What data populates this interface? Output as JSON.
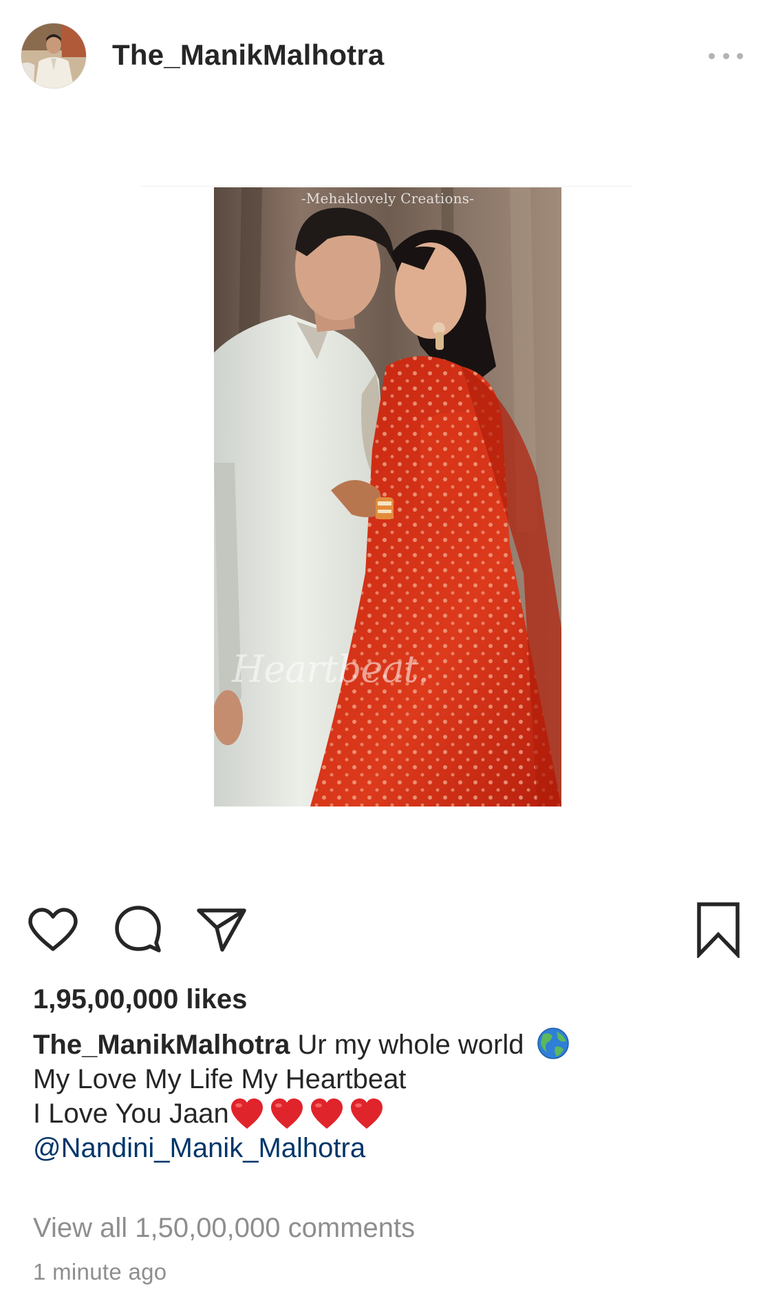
{
  "post": {
    "username": "The_ManikMalhotra",
    "media": {
      "watermark_text": "-Mehaklovely Creations-",
      "signature_text": "Heartbeat."
    },
    "likes_text": "1,95,00,000 likes",
    "caption": {
      "username": "The_ManikMalhotra",
      "line1_text": "Ur my whole world",
      "line1_emoji": "globe-icon",
      "line2_text": "My Love My Life My Heartbeat",
      "line3_text": "I Love You Jaan",
      "line3_emoji": "red-heart-icon",
      "line3_emoji_count": 4,
      "mention": "@Nandini_Manik_Malhotra"
    },
    "view_comments_text": "View all 1,50,00,000 comments",
    "timestamp": "1 minute ago"
  },
  "icons": {
    "more": "more-options-icon",
    "like": "heart-outline-icon",
    "comment": "comment-bubble-icon",
    "share": "paper-plane-icon",
    "save": "bookmark-icon"
  },
  "colors": {
    "text": "#262626",
    "secondary_text": "#8e8e8e",
    "mention": "#003569",
    "heart_emoji": "#e0242b"
  }
}
